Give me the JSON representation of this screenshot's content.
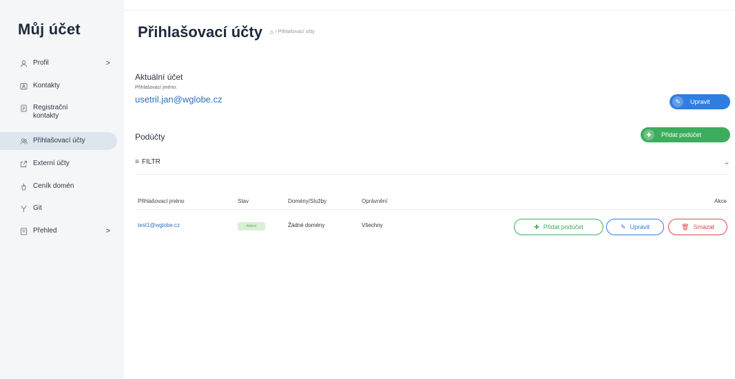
{
  "sidebar": {
    "title": "Můj účet",
    "items": [
      {
        "label": "Profil",
        "icon": "user-icon",
        "chevron": ">"
      },
      {
        "label": "Kontakty",
        "icon": "contact-card-icon"
      },
      {
        "label": "Registrační kontakty",
        "icon": "document-icon"
      },
      {
        "label": "Přihlašovací účty",
        "icon": "users-icon"
      },
      {
        "label": "Externí účty",
        "icon": "external-link-icon"
      },
      {
        "label": "Ceník domén",
        "icon": "price-tag-icon"
      },
      {
        "label": "Git",
        "icon": "git-branch-icon"
      },
      {
        "label": "Přehled",
        "icon": "overview-icon",
        "chevron": ">"
      }
    ]
  },
  "header": {
    "title": "Přihlašovací účty",
    "breadcrumb": "/ Přihlašovací účty"
  },
  "current_account": {
    "heading": "Aktuální účet",
    "login_label": "Přihlašovací jméno:",
    "email": "usetril.jan@wglobe.cz",
    "edit_button": "Upravit"
  },
  "subaccounts": {
    "heading": "Podúčty",
    "add_button": "Přidat podúčet",
    "filter_label": "FILTR"
  },
  "table": {
    "columns": [
      "Přihlašovací jméno",
      "Stav",
      "Domény/Služby",
      "Oprávnění",
      "Akce"
    ],
    "rows": [
      {
        "login": "test1@wglobe.cz",
        "status": "Aktivní",
        "domains": "Žádné domény",
        "permissions": "Všechny",
        "actions": {
          "add": "Přidat podúčet",
          "edit": "Upravit",
          "delete": "Smazat"
        }
      }
    ]
  },
  "colors": {
    "blue": "#2f7de1",
    "green": "#3cad5c",
    "red": "#e0474a",
    "link": "#2d6fbf"
  }
}
